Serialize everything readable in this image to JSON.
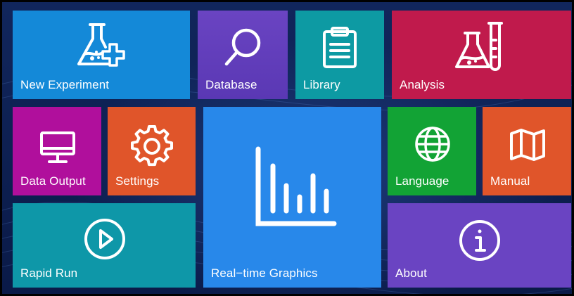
{
  "tiles": {
    "new_experiment": {
      "label": "New Experiment",
      "icon": "flask-plus-icon"
    },
    "database": {
      "label": "Database",
      "icon": "search-icon"
    },
    "library": {
      "label": "Library",
      "icon": "clipboard-icon"
    },
    "analysis": {
      "label": "Analysis",
      "icon": "flask-tube-icon"
    },
    "data_output": {
      "label": "Data Output",
      "icon": "monitor-icon"
    },
    "settings": {
      "label": "Settings",
      "icon": "gear-icon"
    },
    "realtime_graphics": {
      "label": "Real−time Graphics",
      "icon": "bar-chart-icon"
    },
    "language": {
      "label": "Language",
      "icon": "globe-icon"
    },
    "manual": {
      "label": "Manual",
      "icon": "map-icon"
    },
    "rapid_run": {
      "label": "Rapid Run",
      "icon": "play-circle-icon"
    },
    "about": {
      "label": "About",
      "icon": "info-icon"
    }
  },
  "colors": {
    "background": "#0c1c4c",
    "new_experiment": "#1489d8",
    "database": "#6a44c2",
    "library": "#0d9aa3",
    "analysis": "#c01a4c",
    "data_output": "#b00f9c",
    "settings": "#e0552a",
    "realtime_graphics": "#2888ea",
    "language": "#12a335",
    "manual": "#e0552a",
    "rapid_run": "#0e97a8",
    "about": "#6a44c2"
  }
}
